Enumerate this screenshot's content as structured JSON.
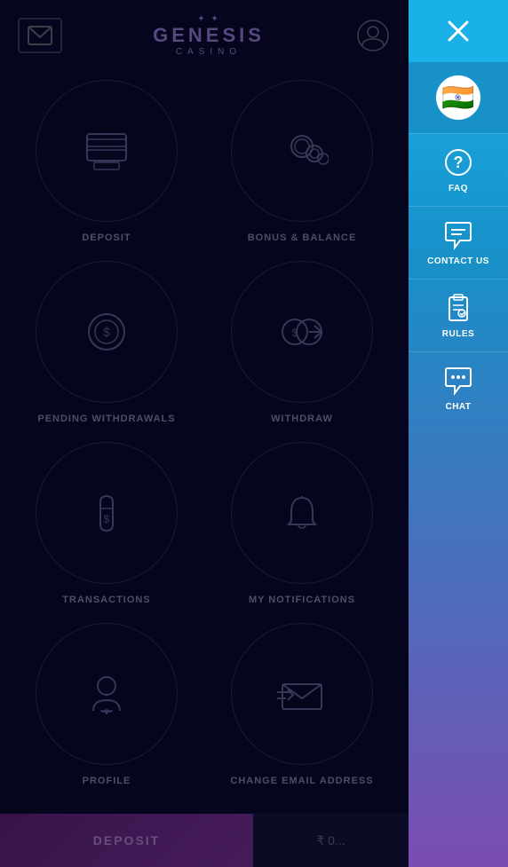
{
  "header": {
    "logo_stars": "✦ ✦",
    "logo_text": "GENESIS",
    "logo_sub": "CASINO"
  },
  "grid": {
    "items": [
      {
        "id": "deposit",
        "label": "DEPOSIT",
        "icon": "deposit"
      },
      {
        "id": "bonus-balance",
        "label": "BONUS & BALANCE",
        "icon": "coins"
      },
      {
        "id": "pending-withdrawals",
        "label": "PENDING WITHDRAWALS",
        "icon": "chip"
      },
      {
        "id": "withdraw",
        "label": "WITHDRAW",
        "icon": "transfer"
      },
      {
        "id": "transactions",
        "label": "TRANSACTIONS",
        "icon": "bag"
      },
      {
        "id": "my-notifications",
        "label": "MY NOTIFICATIONS",
        "icon": "bell"
      },
      {
        "id": "profile",
        "label": "PROFILE",
        "icon": "person"
      },
      {
        "id": "change-email",
        "label": "CHANGE EMAIL ADDRESS",
        "icon": "email"
      }
    ]
  },
  "bottom_bar": {
    "deposit_label": "DEPOSIT",
    "balance_label": "₹ 0..."
  },
  "sidebar": {
    "items": [
      {
        "id": "faq",
        "label": "FAQ",
        "icon": "question"
      },
      {
        "id": "contact-us",
        "label": "CONTACT US",
        "icon": "chat-bubble"
      },
      {
        "id": "rules",
        "label": "RULES",
        "icon": "clipboard"
      },
      {
        "id": "chat",
        "label": "CHAT",
        "icon": "chat-dots"
      }
    ]
  }
}
